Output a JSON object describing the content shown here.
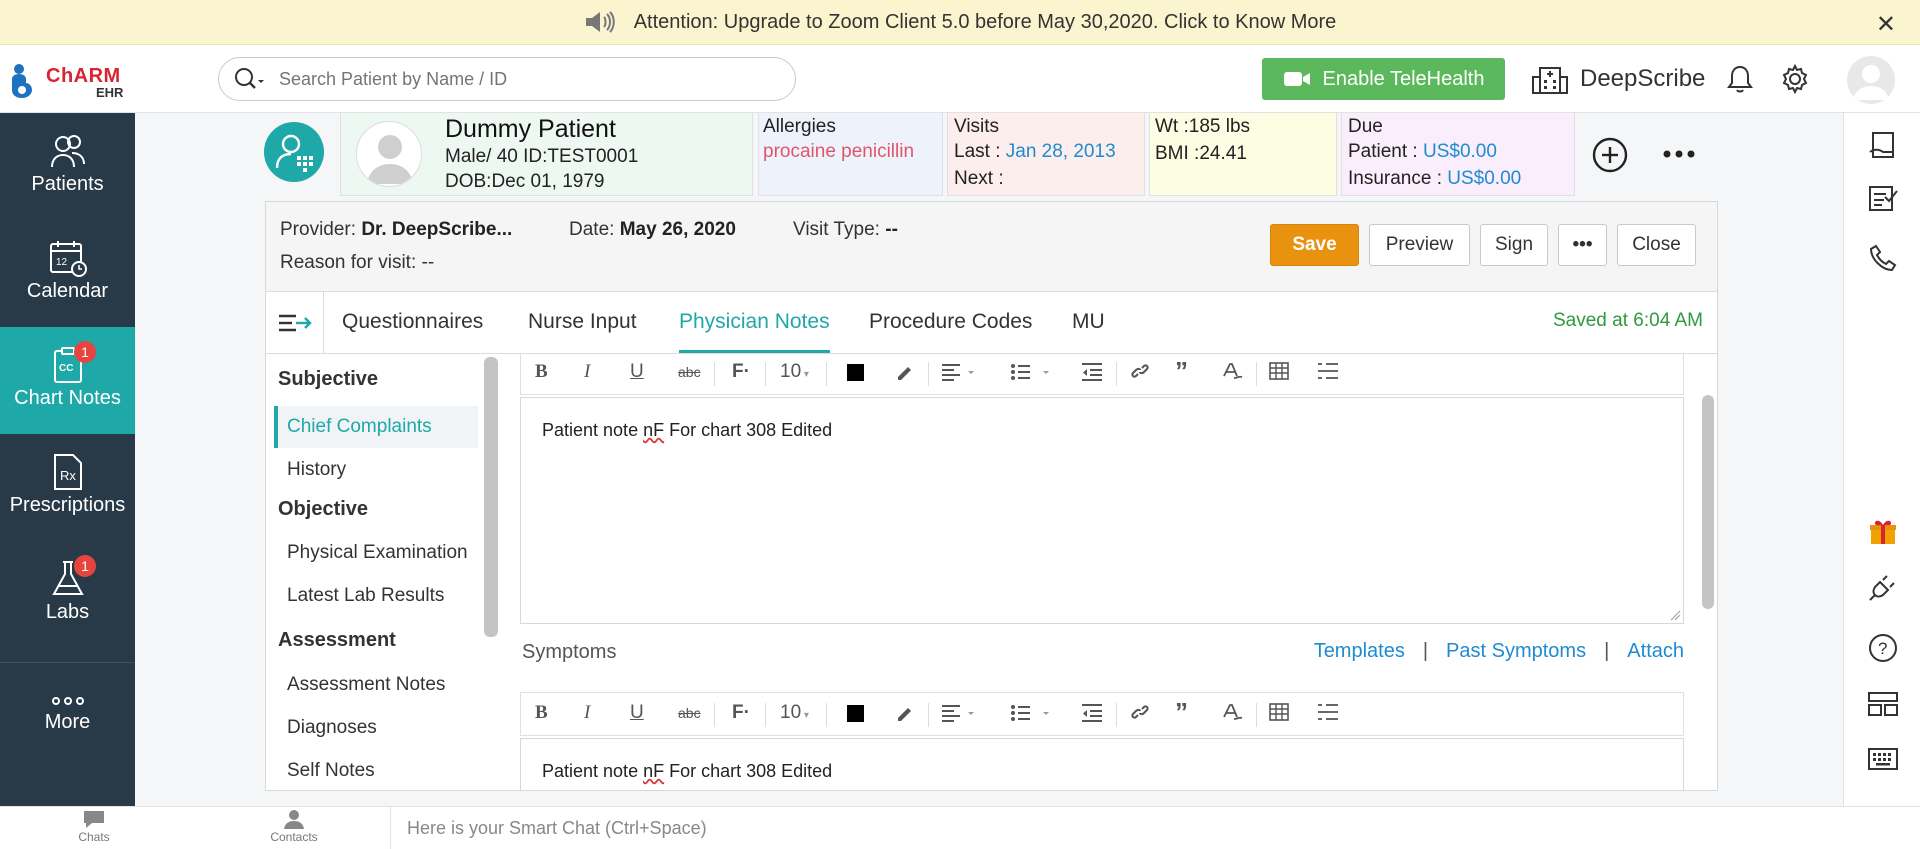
{
  "banner": {
    "message": "Attention: Upgrade to Zoom Client 5.0 before May 30,2020. Click to Know More",
    "close": "✕"
  },
  "header": {
    "logo_brand_a": "Ch",
    "logo_brand_b": "ARM",
    "logo_sub": "EHR",
    "search_placeholder": "Search Patient by Name / ID",
    "telehealth_label": "Enable TeleHealth",
    "practice_name": "DeepScribe"
  },
  "nav": {
    "items": [
      {
        "label": "Patients",
        "icon": "patients-icon"
      },
      {
        "label": "Calendar",
        "icon": "calendar-icon"
      },
      {
        "label": "Chart Notes",
        "icon": "chart-notes-icon",
        "badge": "1"
      },
      {
        "label": "Prescriptions",
        "icon": "prescriptions-icon"
      },
      {
        "label": "Labs",
        "icon": "labs-icon",
        "badge": "1"
      },
      {
        "label": "More",
        "icon": "more-icon"
      }
    ]
  },
  "patient": {
    "name": "Dummy Patient",
    "demographics": "Male/ 40  ID:TEST0001",
    "dob": "DOB:Dec 01, 1979",
    "allergies_label": "Allergies",
    "allergies_value": "procaine penicillin",
    "visits_label": "Visits",
    "last_label": "Last  :",
    "last_value": "Jan 28, 2013",
    "next_label": "Next :",
    "wt_label": "Wt    :",
    "wt_value": "185 lbs",
    "bmi_label": "BMI  :",
    "bmi_value": "24.41",
    "due_label": "Due",
    "due_patient_label": "Patient :",
    "due_patient_value": "US$0.00",
    "due_insurance_label": "Insurance :",
    "due_insurance_value": "US$0.00"
  },
  "encounter": {
    "provider_label": "Provider:",
    "provider_value": "Dr. DeepScribe...",
    "date_label": "Date:",
    "date_value": "May 26, 2020",
    "visit_type_label": "Visit Type:",
    "visit_type_value": "--",
    "reason_label": "Reason for visit:",
    "reason_value": "--",
    "buttons": {
      "save": "Save",
      "preview": "Preview",
      "sign": "Sign",
      "more": "•••",
      "close": "Close"
    }
  },
  "tabs": {
    "items": [
      "Questionnaires",
      "Nurse Input",
      "Physician Notes",
      "Procedure Codes",
      "MU"
    ],
    "active": "Physician Notes",
    "saved_status": "Saved at 6:04 AM"
  },
  "sections": {
    "subjective": "Subjective",
    "chief_complaints": "Chief Complaints",
    "history": "History",
    "objective": "Objective",
    "physical_examination": "Physical Examination",
    "latest_lab_results": "Latest Lab Results",
    "assessment": "Assessment",
    "assessment_notes": "Assessment Notes",
    "diagnoses": "Diagnoses",
    "self_notes": "Self Notes"
  },
  "editor": {
    "font_size": "10",
    "chief_text_a": "Patient note ",
    "chief_text_sp": "nF",
    "chief_text_b": " For chart 308 Edited",
    "symptoms_label": "Symptoms",
    "symptoms_links": [
      "Templates",
      "Past Symptoms",
      "Attach"
    ],
    "symptoms_text_a": "Patient note ",
    "symptoms_text_sp": "nF",
    "symptoms_text_b": " For chart 308 Edited"
  },
  "bottombar": {
    "chats": "Chats",
    "contacts": "Contacts",
    "smartchat_placeholder": "Here is your Smart Chat (Ctrl+Space)"
  },
  "colors": {
    "teal": "#1fa8a8",
    "nav_bg": "#283947",
    "save_orange": "#e8920f",
    "telehealth_green": "#5cb85c",
    "link_blue": "#1e8bd1",
    "badge_red": "#e5443f"
  }
}
